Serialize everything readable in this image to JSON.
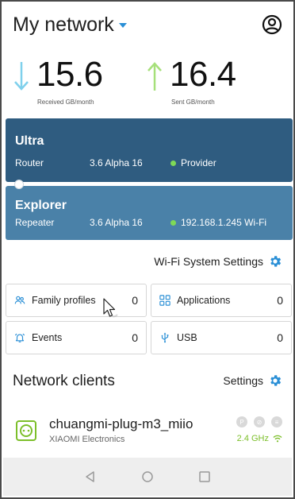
{
  "header": {
    "title": "My network"
  },
  "speeds": {
    "received_value": "15.6",
    "received_caption": "Received GB/month",
    "sent_value": "16.4",
    "sent_caption": "Sent GB/month"
  },
  "devices": [
    {
      "name": "Ultra",
      "role": "Router",
      "version": "3.6 Alpha 16",
      "status": "Provider"
    },
    {
      "name": "Explorer",
      "role": "Repeater",
      "version": "3.6 Alpha 16",
      "status": "192.168.1.245 Wi-Fi"
    }
  ],
  "wifi_settings_label": "Wi-Fi System Settings",
  "tiles": [
    {
      "label": "Family profiles",
      "count": "0",
      "icon": "family-profiles-icon"
    },
    {
      "label": "Applications",
      "count": "0",
      "icon": "applications-icon"
    },
    {
      "label": "Events",
      "count": "0",
      "icon": "alarm-bell-icon"
    },
    {
      "label": "USB",
      "count": "0",
      "icon": "usb-icon"
    }
  ],
  "clients": {
    "title": "Network clients",
    "settings_label": "Settings",
    "items": [
      {
        "name": "chuangmi-plug-m3_miio",
        "vendor": "XIAOMI Electronics",
        "band": "2.4 GHz"
      }
    ]
  },
  "colors": {
    "accent": "#2a8fd6",
    "router_card": "#2f5c80",
    "repeater_card": "#4a81a8",
    "online": "#7ed957",
    "band": "#7cbf2a"
  }
}
